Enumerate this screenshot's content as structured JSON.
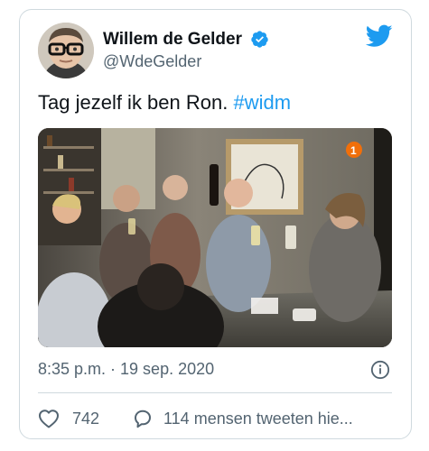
{
  "author": {
    "display_name": "Willem de Gelder",
    "handle": "@WdeGelder",
    "verified": true
  },
  "tweet": {
    "text": "Tag jezelf ik ben Ron. ",
    "hashtag": "#widm",
    "media": {
      "kind": "video-still",
      "channel_logo_icon": "npo1-logo-icon"
    },
    "timestamp": "8:35 p.m. · 19 sep. 2020"
  },
  "actions": {
    "like_count": "742",
    "reply_label": "114 mensen tweeten hie..."
  },
  "icons": {
    "verified": "verified-badge-icon",
    "brand": "twitter-bird-icon",
    "info": "info-icon",
    "like": "heart-icon",
    "reply": "speech-bubble-icon"
  },
  "colors": {
    "accent": "#1d9bf0",
    "text_primary": "#0f1419",
    "text_secondary": "#536471",
    "border": "#cfd9de"
  }
}
